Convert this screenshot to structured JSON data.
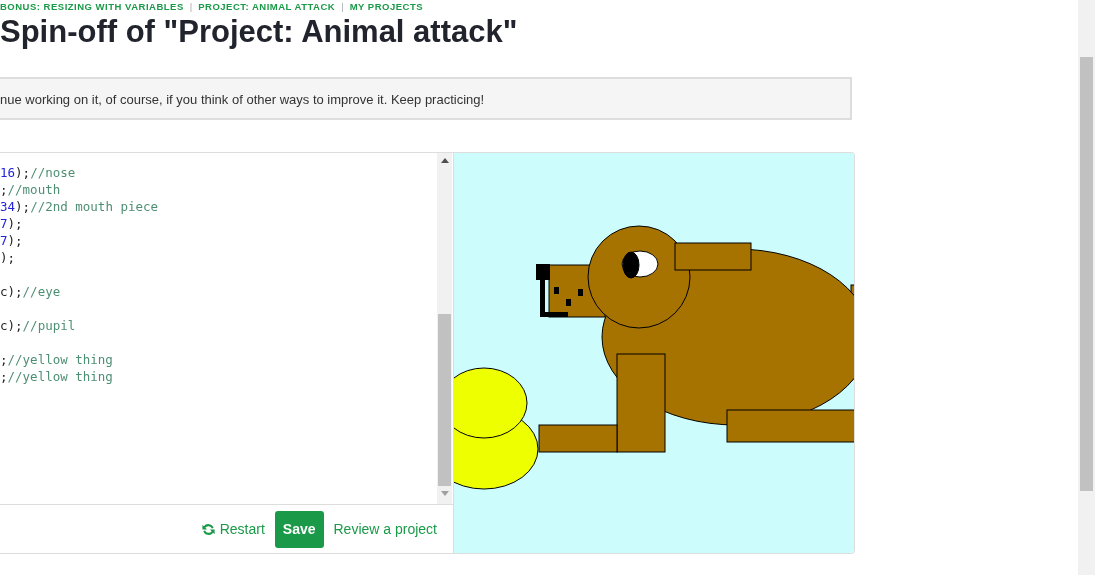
{
  "breadcrumb": [
    "BONUS: RESIZING WITH VARIABLES",
    "PROJECT: ANIMAL ATTACK",
    "MY PROJECTS"
  ],
  "breadcrumb_separator": "|",
  "title": "Spin-off of \"Project: Animal attack\"",
  "notice": "nue working on it, of course, if you think of other ways to improve it. Keep practicing!",
  "code_lines": [
    {
      "kind": "code",
      "tokens": [
        {
          "kind": "number",
          "text": "16"
        },
        {
          "kind": "plain",
          "text": ");"
        },
        {
          "kind": "comment",
          "text": "//nose"
        }
      ]
    },
    {
      "kind": "code",
      "tokens": [
        {
          "kind": "plain",
          "text": ";"
        },
        {
          "kind": "comment",
          "text": "//mouth"
        }
      ]
    },
    {
      "kind": "code",
      "tokens": [
        {
          "kind": "number",
          "text": "34"
        },
        {
          "kind": "plain",
          "text": ");"
        },
        {
          "kind": "comment",
          "text": "//2nd mouth piece"
        }
      ]
    },
    {
      "kind": "code",
      "tokens": [
        {
          "kind": "number",
          "text": "7"
        },
        {
          "kind": "plain",
          "text": ");"
        }
      ]
    },
    {
      "kind": "code",
      "tokens": [
        {
          "kind": "number",
          "text": "7"
        },
        {
          "kind": "plain",
          "text": ");"
        }
      ]
    },
    {
      "kind": "code",
      "tokens": [
        {
          "kind": "plain",
          "text": ");"
        }
      ]
    },
    {
      "kind": "blank"
    },
    {
      "kind": "code",
      "tokens": [
        {
          "kind": "plain",
          "text": "c);"
        },
        {
          "kind": "comment",
          "text": "//eye"
        }
      ]
    },
    {
      "kind": "blank"
    },
    {
      "kind": "code",
      "tokens": [
        {
          "kind": "plain",
          "text": "c);"
        },
        {
          "kind": "comment",
          "text": "//pupil"
        }
      ]
    },
    {
      "kind": "blank"
    },
    {
      "kind": "code",
      "tokens": [
        {
          "kind": "plain",
          "text": ";"
        },
        {
          "kind": "comment",
          "text": "//yellow thing"
        }
      ]
    },
    {
      "kind": "code",
      "tokens": [
        {
          "kind": "plain",
          "text": ";"
        },
        {
          "kind": "comment",
          "text": "//yellow thing"
        }
      ]
    }
  ],
  "actions": {
    "restart": "Restart",
    "save": "Save",
    "review": "Review a project"
  }
}
